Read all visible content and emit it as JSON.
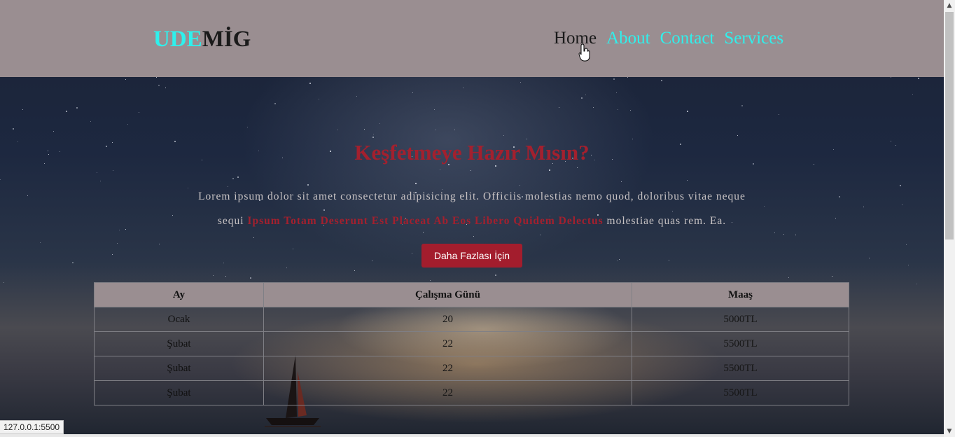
{
  "brand": {
    "part1": "UDE",
    "part2": "MİG"
  },
  "nav": {
    "items": [
      {
        "label": "Home"
      },
      {
        "label": "About"
      },
      {
        "label": "Contact"
      },
      {
        "label": "Services"
      }
    ]
  },
  "hero": {
    "title": "Keşfetmeye Hazır Mısın?",
    "text_before": "Lorem ipsum dolor sit amet consectetur adipisicing elit. Officiis molestias nemo quod, doloribus vitae neque sequi ",
    "text_highlight": "Ipsum Totam Deserunt Est Placeat Ab Eos Libero Quidem Delectus",
    "text_after": " molestiae quas rem. Ea.",
    "button_label": "Daha Fazlası İçin"
  },
  "table": {
    "headers": [
      "Ay",
      "Çalışma Günü",
      "Maaş"
    ],
    "rows": [
      [
        "Ocak",
        "20",
        "5000TL"
      ],
      [
        "Şubat",
        "22",
        "5500TL"
      ],
      [
        "Şubat",
        "22",
        "5500TL"
      ],
      [
        "Şubat",
        "22",
        "5500TL"
      ]
    ]
  },
  "status_bar": {
    "url": "127.0.0.1:5500"
  },
  "colors": {
    "accent": "#2ff0ec",
    "brand_red": "#a3202e",
    "navbar_bg": "#9a8e91"
  },
  "icons": {
    "cursor": "hand-pointer-icon",
    "scroll_up": "arrow-up-icon",
    "scroll_down": "arrow-down-icon"
  }
}
